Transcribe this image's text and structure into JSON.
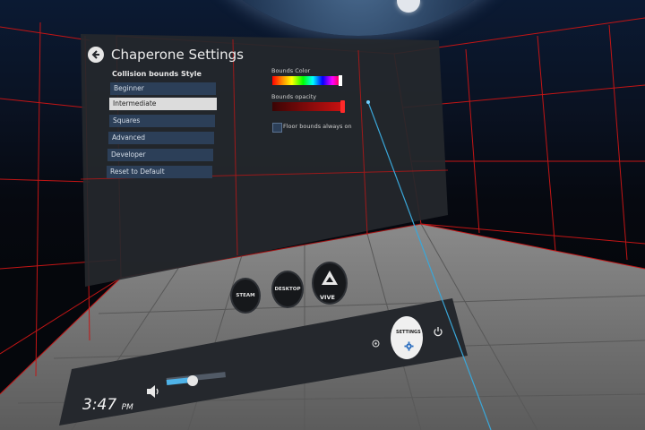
{
  "panel": {
    "title": "Chaperone Settings",
    "section_label": "Collision bounds Style",
    "style_options": [
      {
        "label": "Beginner",
        "selected": false
      },
      {
        "label": "Intermediate",
        "selected": true
      },
      {
        "label": "Squares",
        "selected": false
      },
      {
        "label": "Advanced",
        "selected": false
      },
      {
        "label": "Developer",
        "selected": false
      },
      {
        "label": "Reset to Default",
        "selected": false
      }
    ],
    "bounds_color_label": "Bounds Color",
    "bounds_opacity_label": "Bounds opacity",
    "floor_bounds_label": "Floor bounds always on",
    "floor_bounds_checked": false
  },
  "dashboard": {
    "steam_label": "STEAM",
    "desktop_label": "DESKTOP",
    "vive_label": "VIVE",
    "settings_label": "SETTINGS",
    "clock_time": "3:47",
    "clock_suffix": "PM",
    "volume_level": 0.4
  },
  "colors": {
    "bounds_red": "#cc1111",
    "panel_item": "#2c3f58",
    "volume_accent": "#4fb3e8"
  }
}
